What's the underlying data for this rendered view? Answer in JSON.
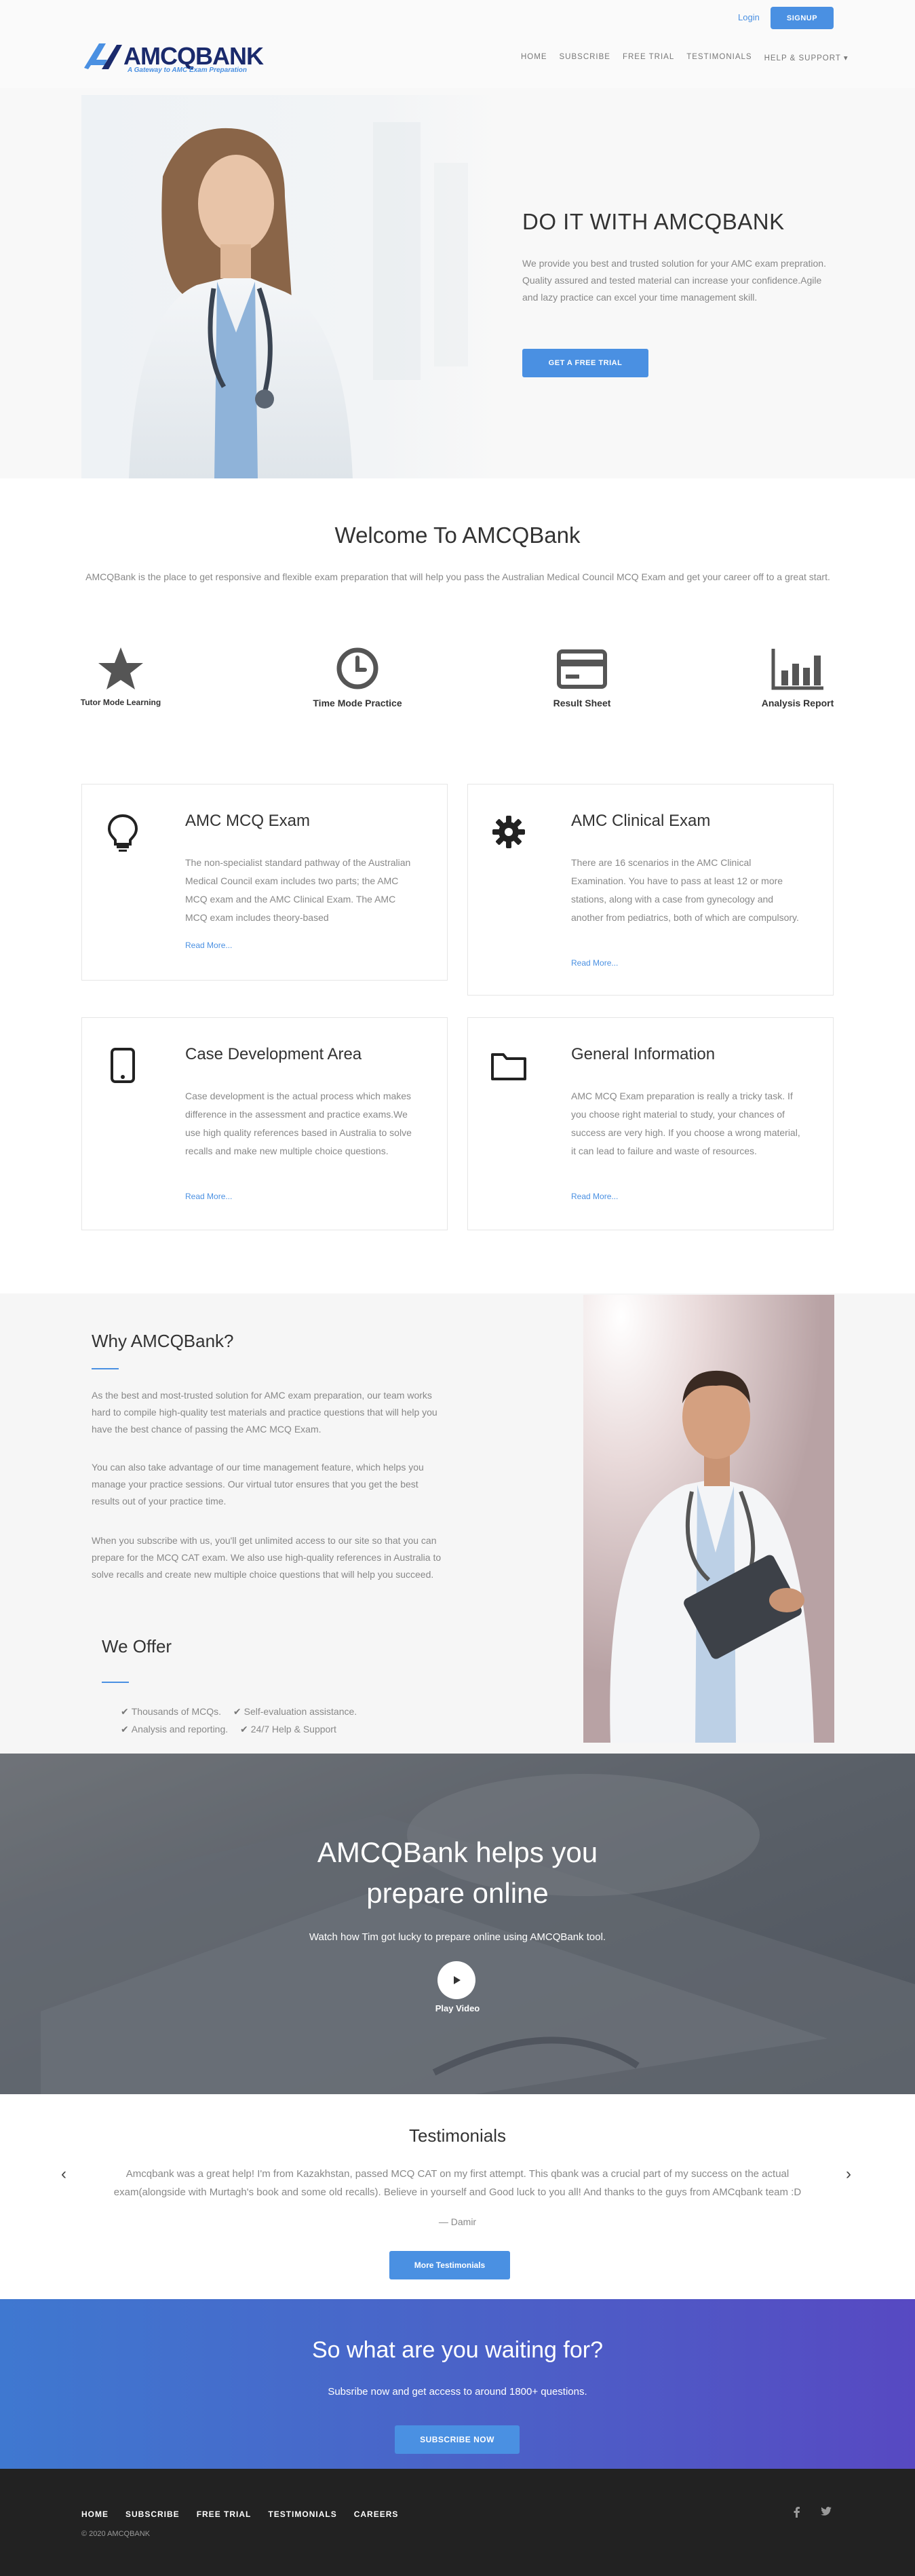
{
  "header": {
    "login": "Login",
    "signup": "SIGNUP",
    "logo_text": "AMCQBANK",
    "logo_tagline": "A Gateway to AMC Exam Preparation",
    "nav": [
      "HOME",
      "SUBSCRIBE",
      "FREE TRIAL",
      "TESTIMONIALS",
      "HELP & SUPPORT ▾"
    ]
  },
  "hero": {
    "title": "DO IT WITH AMCQBANK",
    "text": "We provide you best and trusted solution for your AMC exam prepration. Quality assured and tested material can increase your confidence.Agile and lazy practice can excel your time management skill.",
    "button": "GET A FREE TRIAL"
  },
  "welcome": {
    "title": "Welcome To AMCQBank",
    "text": "AMCQBank is the place to get responsive and flexible exam preparation that will help you pass the Australian Medical Council MCQ Exam and get your career off to a great start.",
    "features": [
      {
        "label": "Tutor Mode Learning",
        "icon": "star-icon"
      },
      {
        "label": "Time Mode Practice",
        "icon": "clock-icon"
      },
      {
        "label": "Result Sheet",
        "icon": "credit-card-icon"
      },
      {
        "label": "Analysis Report",
        "icon": "bar-chart-icon"
      }
    ]
  },
  "cards": [
    {
      "title": "AMC MCQ Exam",
      "icon": "lightbulb-icon",
      "text": "The non-specialist standard pathway of the Australian Medical Council exam includes two parts; the AMC MCQ exam and the AMC Clinical Exam. The AMC MCQ exam includes theory-based",
      "link": "Read More..."
    },
    {
      "title": "AMC Clinical Exam",
      "icon": "gear-icon",
      "text": "There are 16 scenarios in the AMC Clinical Examination. You have to pass at least 12 or more stations, along with a case from gynecology and another from pediatrics, both of which are compulsory.",
      "link": "Read More..."
    },
    {
      "title": "Case Development Area",
      "icon": "tablet-icon",
      "text": "Case development is the actual process which makes difference in the assessment and practice exams.We use high quality references based in Australia to solve recalls and make new multiple choice questions.",
      "link": "Read More..."
    },
    {
      "title": "General Information",
      "icon": "folder-icon",
      "text": "AMC MCQ Exam preparation is really a tricky task. If you choose right material to study, your chances of success are very high. If you choose a wrong material, it can lead to failure and waste of resources.",
      "link": "Read More..."
    }
  ],
  "why": {
    "title": "Why AMCQBank?",
    "paragraphs": [
      "As the best and most-trusted solution for AMC exam preparation, our team works hard to compile high-quality test materials and practice questions that will help you have the best chance of passing the AMC MCQ Exam.",
      "You can also take advantage of our time management feature, which helps you manage your practice sessions. Our virtual tutor ensures that you get the best results out of your practice time.",
      "When you subscribe with us, you'll get unlimited access to our site so that you can prepare for the MCQ CAT exam. We also use high-quality references in Australia to solve recalls and create new multiple choice questions that will help you succeed."
    ],
    "offer_title": "We Offer",
    "offers": [
      "Thousands of MCQs.",
      "Self-evaluation assistance.",
      "Analysis and reporting.",
      "24/7 Help & Support"
    ]
  },
  "video": {
    "title_line1": "AMCQBank helps you",
    "title_line2": "prepare online",
    "subtitle": "Watch how Tim got lucky to prepare online using AMCQBank tool.",
    "play_label": "Play Video"
  },
  "testimonials": {
    "title": "Testimonials",
    "quote": "Amcqbank was a great help! I'm from Kazakhstan, passed MCQ CAT on my first attempt. This qbank was a crucial part of my success on the actual exam(alongside with Murtagh's book and some old recalls). Believe in yourself and Good luck to you all! And thanks to the guys from AMCqbank team :D",
    "author": "— Damir",
    "button": "More Testimonials",
    "prev": "‹",
    "next": "›"
  },
  "cta": {
    "title": "So what are you waiting for?",
    "subtitle": "Subsribe now and get access to around 1800+ questions.",
    "button": "SUBSCRIBE NOW"
  },
  "footer": {
    "nav": [
      "HOME",
      "SUBSCRIBE",
      "FREE TRIAL",
      "TESTIMONIALS",
      "CAREERS"
    ],
    "copyright": "© 2020 AMCQBANK",
    "social": [
      "facebook-icon",
      "twitter-icon"
    ]
  },
  "colors": {
    "accent": "#4a90e2",
    "footer": "#222222",
    "cta_gradient_start": "#3f78d0",
    "cta_gradient_end": "#5749c2"
  }
}
